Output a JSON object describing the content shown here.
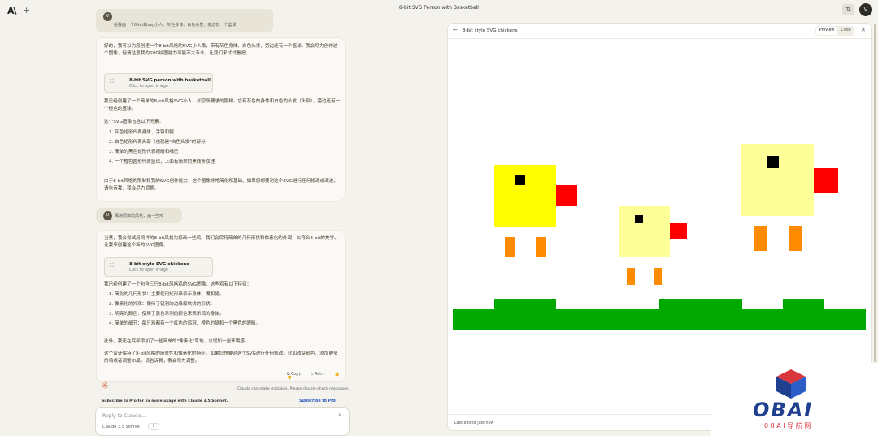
{
  "top": {
    "logo": "A\\",
    "new_chat": "+",
    "title": "8-bit SVG Person with Basketball",
    "user_initial": "V"
  },
  "chat": {
    "msg1": {
      "initial": "V",
      "text": "给我画一个8-bit的svg小人。灰色身体、白色头发、旁边有一个篮球"
    },
    "reply1": {
      "intro": "好的，我可以为您创建一个8-bit风格的SVG小人像，带有灰色身体、白色头发，旁边还有一个篮球。我会尽力创作这个图像，但请注意我的SVG绘图能力可能不太专业，让我们来试试看吧。",
      "artifact_title": "8-bit SVG person with basketball",
      "artifact_sub": "Click to open image",
      "p1": "我已经创建了一个简单的8-bit风格SVG小人，如您所要求的那样，它有灰色的身体和白色的头发（头部），旁边还有一个橙色的篮球。",
      "p2": "这个SVG图像包含以下元素：",
      "items": [
        "1. 灰色矩形代表身体、手臂和腿",
        "2. 白色矩形代表头部（也就是\"白色头发\"的部分）",
        "3. 简单的黑色矩形代表眼睛和嘴巴",
        "4. 一个橙色圆形代表篮球，上面有简单的黑线条纹理"
      ],
      "p3": "由于8-bit风格的限制和我的SVG创作能力，这个图像非常简化和基础。如果您想要对这个SVG进行任何修改或改进，请告诉我，我会尽力调整。"
    },
    "msg2": {
      "initial": "V",
      "text": "再用同样的风格，画一些鸡"
    },
    "reply2": {
      "intro": "当然，我会尝试用同样的8-bit风格为您画一些鸡。我们会保持简单的几何形状和像素化的外观，以符合8-bit的美学。让我来创建这个新的SVG图像。",
      "artifact_title": "8-bit style SVG chickens",
      "artifact_sub": "Click to open image",
      "p1": "我已经创建了一个包含三只8-bit风格鸡的SVG图像。这些鸡有以下特征：",
      "items": [
        "1. 简化的几何形状：主要使用矩形来表示身体、嘴和腿。",
        "2. 像素化的外观：保持了锐利的边缘和块状的形状。",
        "3. 明亮的颜色：使用了黄色系列的颜色来表示鸡的身体。",
        "4. 简单的细节：每只鸡都有一个红色的鸡冠、橙色的腿和一个黑色的眼睛。"
      ],
      "p2": "此外，我还在底部添加了一些简单的\"像素化\"草地，以增加一些环境感。",
      "p3": "这个设计保持了8-bit风格的简单性和像素化的特征。如果您想要对这个SVG进行任何修改，比如改变颜色、添加更多的鸡或者调整布局，请告诉我，我会尽力调整。"
    },
    "actions": {
      "copy": "Copy",
      "retry": "Retry"
    },
    "disclaimer": "Claude can make mistakes. Please double-check responses.",
    "subscribe_text": "Subscribe to Pro for 5x more usage with Claude 3.5 Sonnet.",
    "subscribe_link": "Subscribe to Pro",
    "input_placeholder": "Reply to Claude...",
    "model": "Claude 3.5 Sonnet",
    "attach_count": "1"
  },
  "panel": {
    "title": "8-bit style SVG chickens",
    "tab_preview": "Preview",
    "tab_code": "Code",
    "last_edited": "Last edited just now"
  },
  "colors": {
    "chick_yellow": "#ffff00",
    "chick_pale": "#ffff99",
    "comb_red": "#ff0000",
    "leg_orange": "#ff8c00",
    "grass_green": "#00a800",
    "eye_black": "#000000"
  },
  "watermark": {
    "brand": "OBAI",
    "sub": "0 8 A I 导 航 网"
  }
}
